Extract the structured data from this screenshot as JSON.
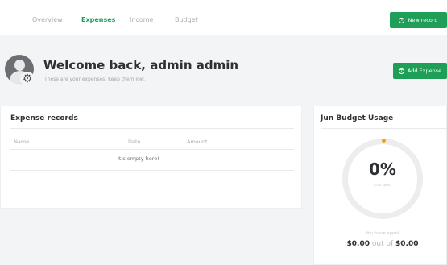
{
  "nav": {
    "tabs": [
      {
        "label": "Overview"
      },
      {
        "label": "Expenses"
      },
      {
        "label": "Income"
      },
      {
        "label": "Budget"
      }
    ],
    "new_record_label": "New record"
  },
  "header": {
    "welcome": "Welcome back, admin admin",
    "subtitle": "These are your expenses. Keep them low.",
    "add_expense_label": "Add Expense"
  },
  "expenses": {
    "title": "Expense records",
    "columns": [
      "Name",
      "Date",
      "Amount"
    ],
    "empty_text": "It's empty here!"
  },
  "budget": {
    "title": "Jun Budget Usage",
    "percent": "0%",
    "percent_sub": "(0.00 Spent)",
    "spent_label": "You have spent",
    "spent_amount": "$0.00",
    "out_of": "out of",
    "budget_amount": "$0.00",
    "accent_color": "#f0a500"
  },
  "colors": {
    "brand": "#1e9e56",
    "active_tab": "#1f9d55"
  }
}
